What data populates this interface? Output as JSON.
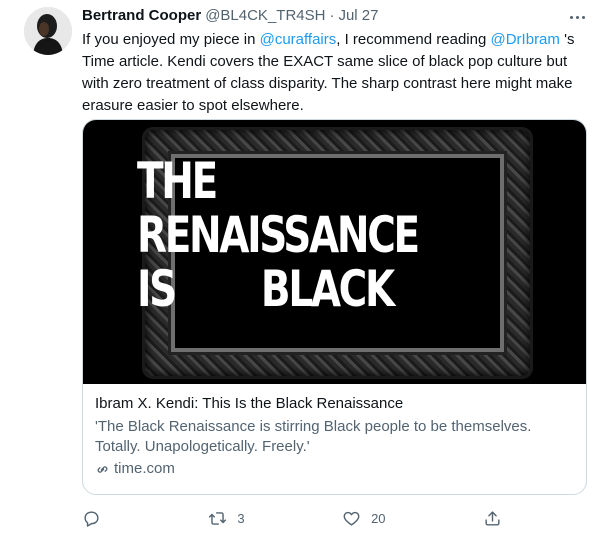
{
  "tweet": {
    "author_name": "Bertrand Cooper",
    "handle": "@BL4CK_TR4SH",
    "separator": "·",
    "date": "Jul 27",
    "text": {
      "t1": "If you enjoyed my piece in ",
      "mention1": "@curaffairs",
      "t2": ", I recommend reading ",
      "mention2": "@DrIbram",
      "t3": " 's Time article. Kendi covers the EXACT same slice of black pop culture but with zero treatment of class disparity. The sharp contrast here might make erasure easier to spot elsewhere."
    }
  },
  "card": {
    "headline": {
      "line1": "THE",
      "line2": "RENAISSANCE",
      "line3a": "IS",
      "line3b": "BLACK"
    },
    "title": "Ibram X. Kendi: This Is the Black Renaissance",
    "description": "'The Black Renaissance is stirring Black people to be themselves. Totally. Unapologetically. Freely.'",
    "domain": "time.com"
  },
  "actions": {
    "reply": {
      "icon": "reply-icon",
      "count": ""
    },
    "retweet": {
      "icon": "retweet-icon",
      "count": "3"
    },
    "like": {
      "icon": "heart-icon",
      "count": "20"
    },
    "share": {
      "icon": "share-icon",
      "count": ""
    }
  },
  "colors": {
    "link": "#1d9bf0",
    "secondary_text": "#536471",
    "border": "#cfd9de"
  }
}
